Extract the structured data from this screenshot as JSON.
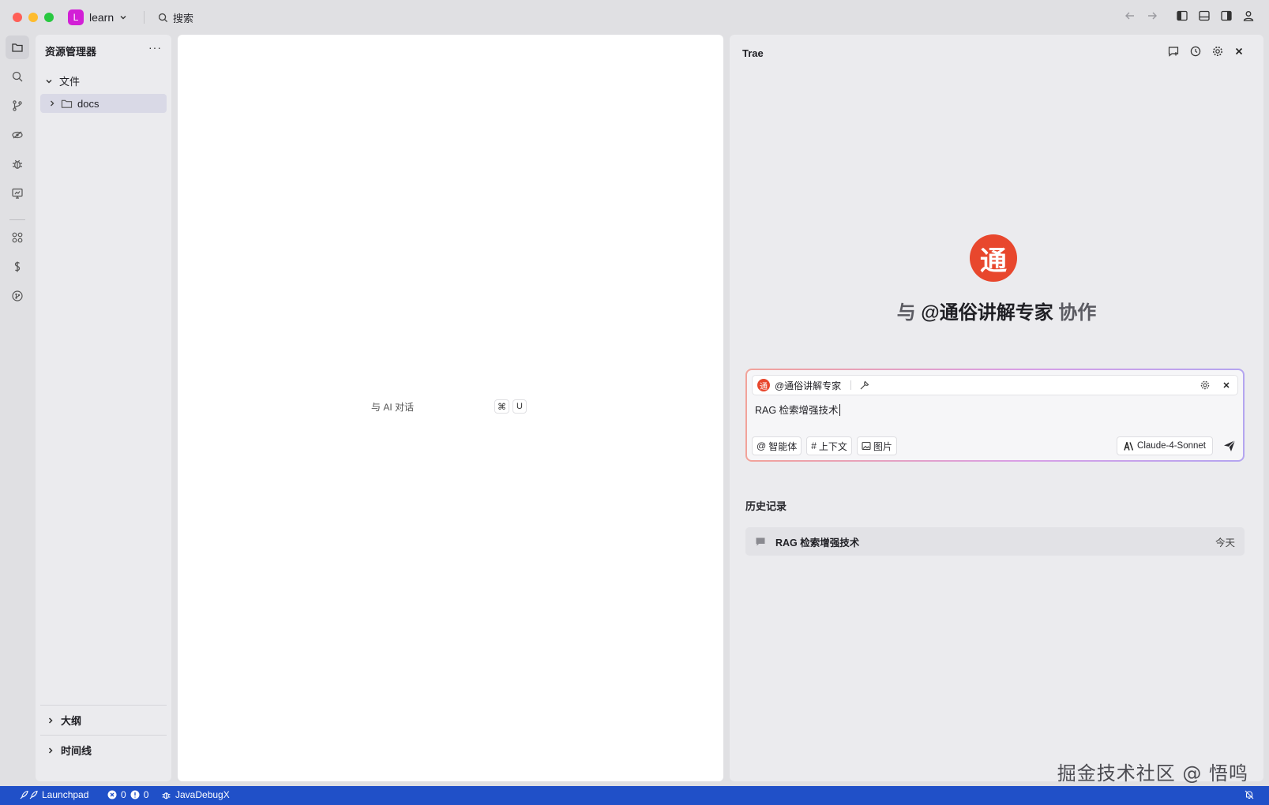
{
  "window": {
    "project_initial": "L",
    "project_name": "learn",
    "search_label": "搜索"
  },
  "explorer": {
    "title": "资源管理器",
    "more": "···",
    "section_label": "文件",
    "items": [
      {
        "label": "docs"
      }
    ],
    "outline_label": "大纲",
    "timeline_label": "时间线"
  },
  "editor": {
    "hint_label": "与 AI 对话",
    "shortcut_mod": "⌘",
    "shortcut_key": "U"
  },
  "trae": {
    "title": "Trae",
    "agent_logo_char": "通",
    "collab_prefix": "与",
    "collab_agent": "@通俗讲解专家",
    "collab_suffix": "协作",
    "chat": {
      "agent_name": "@通俗讲解专家",
      "input_value": "RAG 检索增强技术",
      "tool_agent": "智能体",
      "tool_context": "上下文",
      "tool_image": "图片",
      "model": "Claude-4-Sonnet"
    },
    "history_title": "历史记录",
    "history": [
      {
        "label": "RAG 检索增强技术",
        "date": "今天"
      }
    ]
  },
  "watermark": "掘金技术社区 @ 悟鸣",
  "statusbar": {
    "launchpad": "Launchpad",
    "errors": "0",
    "warnings": "0",
    "debug": "JavaDebugX"
  },
  "colors": {
    "status_bar": "#2050c8",
    "agent_logo": "#e8472d",
    "project_avatar": "#d21fd6"
  }
}
